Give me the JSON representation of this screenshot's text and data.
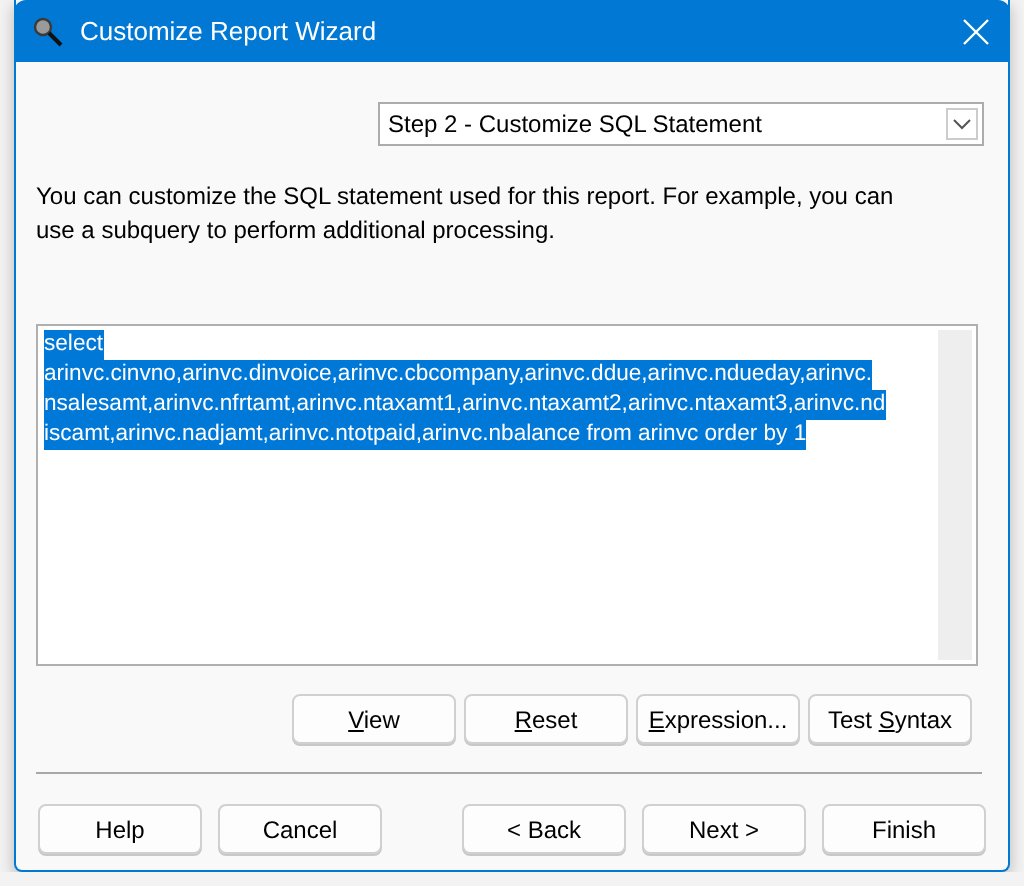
{
  "window": {
    "title": "Customize Report Wizard"
  },
  "step_dropdown": {
    "value": "Step 2 - Customize SQL Statement"
  },
  "description": "You can customize the SQL statement used for this report. For example, you can use a subquery to perform additional processing.",
  "sql_editor": {
    "selected": true,
    "lines": [
      "select",
      "arinvc.cinvno,arinvc.dinvoice,arinvc.cbcompany,arinvc.ddue,arinvc.ndueday,arinvc.",
      "nsalesamt,arinvc.nfrtamt,arinvc.ntaxamt1,arinvc.ntaxamt2,arinvc.ntaxamt3,arinvc.nd",
      "iscamt,arinvc.nadjamt,arinvc.ntotpaid,arinvc.nbalance from arinvc order by 1"
    ]
  },
  "editor_buttons": [
    {
      "key": "V",
      "after": "iew"
    },
    {
      "key": "R",
      "after": "eset"
    },
    {
      "key": "E",
      "after": "xpression..."
    },
    {
      "before": "Test ",
      "key": "S",
      "after": "yntax"
    }
  ],
  "footer_left_buttons": [
    "Help",
    "Cancel"
  ],
  "footer_right_buttons": [
    "< Back",
    "Next >",
    "Finish"
  ]
}
